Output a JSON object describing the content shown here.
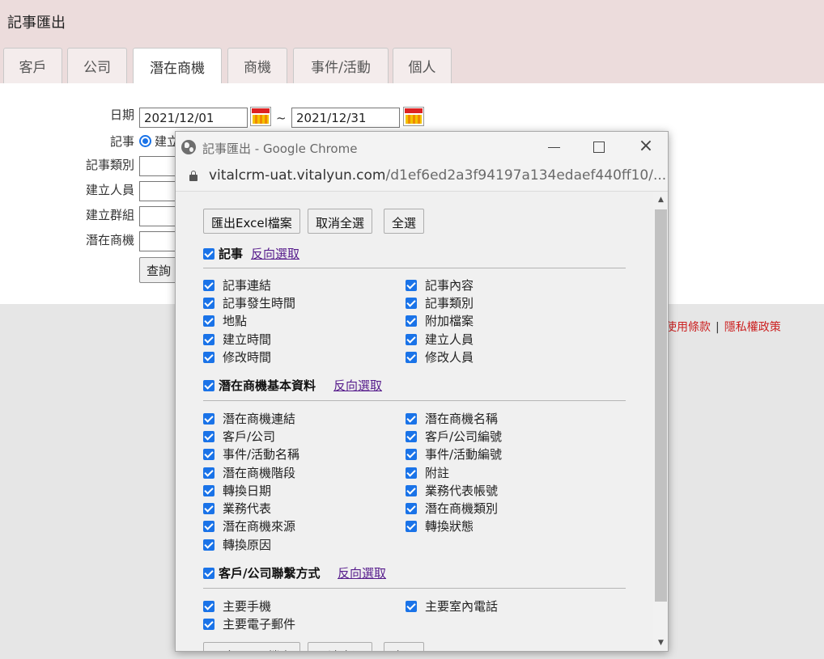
{
  "page": {
    "title": "記事匯出"
  },
  "tabs": [
    {
      "label": "客戶"
    },
    {
      "label": "公司"
    },
    {
      "label": "潛在商機"
    },
    {
      "label": "商機"
    },
    {
      "label": "事件/活動"
    },
    {
      "label": "個人"
    }
  ],
  "form": {
    "date_label": "日期",
    "date_from": "2021/12/01",
    "tilde": "~",
    "date_to": "2021/12/31",
    "record_label": "記事",
    "record_radio_text": "建立",
    "record_type_label": "記事類別",
    "creator_label": "建立人員",
    "group_label": "建立群組",
    "lead_label": "潛在商機",
    "query_button": "查詢"
  },
  "footer": {
    "terms": "使用條款",
    "separator": "|",
    "privacy": "隱私權政策"
  },
  "popup": {
    "window_title": "記事匯出 - Google Chrome",
    "url_host": "vitalcrm-uat.vitalyun.com",
    "url_path": "/d1ef6ed2a3f94197a134edaef440ff10/...",
    "buttons": {
      "export": "匯出Excel檔案",
      "deselect_all": "取消全選",
      "select_all": "全選"
    },
    "sections": [
      {
        "title": "記事",
        "invert": "反向選取",
        "fields": [
          "記事連結",
          "記事內容",
          "記事發生時間",
          "記事類別",
          "地點",
          "附加檔案",
          "建立時間",
          "建立人員",
          "修改時間",
          "修改人員"
        ]
      },
      {
        "title": "潛在商機基本資料",
        "invert": "反向選取",
        "fields": [
          "潛在商機連結",
          "潛在商機名稱",
          "客戶/公司",
          "客戶/公司編號",
          "事件/活動名稱",
          "事件/活動編號",
          "潛在商機階段",
          "附註",
          "轉換日期",
          "業務代表帳號",
          "業務代表",
          "潛在商機類別",
          "潛在商機來源",
          "轉換狀態",
          "轉換原因"
        ]
      },
      {
        "title": "客戶/公司聯繫方式",
        "invert": "反向選取",
        "fields": [
          "主要手機",
          "主要室內電話",
          "主要電子郵件"
        ]
      }
    ]
  },
  "colors": {
    "accent": "#1a73e8",
    "header_bg": "#ecdcdc",
    "link_red": "#cc2222",
    "visited_link": "#551a8b"
  }
}
